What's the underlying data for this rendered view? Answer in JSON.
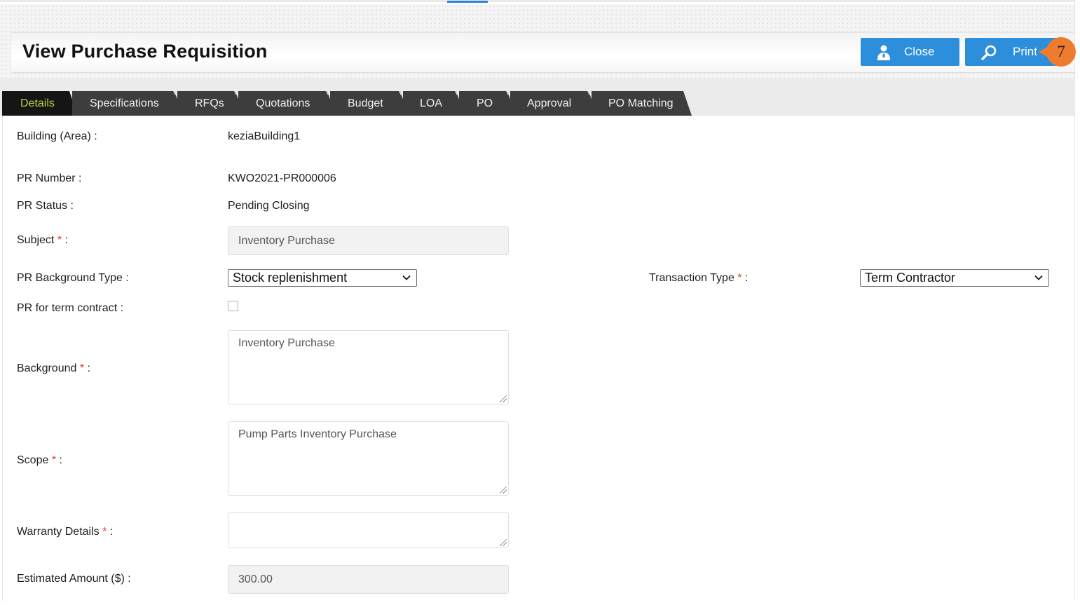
{
  "header": {
    "title": "View Purchase Requisition",
    "close_label": "Close",
    "print_label": "Print",
    "step_badge": "7",
    "accent_color": "#2d8fdb",
    "badge_color": "#ef7c2e"
  },
  "tabs": [
    {
      "label": "Details",
      "active": true
    },
    {
      "label": "Specifications"
    },
    {
      "label": "RFQs"
    },
    {
      "label": "Quotations"
    },
    {
      "label": "Budget"
    },
    {
      "label": "LOA"
    },
    {
      "label": "PO"
    },
    {
      "label": "Approval"
    },
    {
      "label": "PO Matching"
    }
  ],
  "form": {
    "building": {
      "label": "Building (Area) :",
      "value": "keziaBuilding1"
    },
    "pr_number": {
      "label": "PR Number :",
      "value": "KWO2021-PR000006"
    },
    "pr_status": {
      "label": "PR Status :",
      "value": "Pending Closing"
    },
    "subject": {
      "label": "Subject",
      "suffix": " :",
      "value": "Inventory Purchase"
    },
    "pr_background_type": {
      "label": "PR Background Type :",
      "value": "Stock replenishment"
    },
    "transaction_type": {
      "label": "Transaction Type",
      "suffix": " :",
      "value": "Term Contractor"
    },
    "pr_term_contract": {
      "label": "PR for term contract :",
      "checked": false
    },
    "background": {
      "label": "Background",
      "suffix": " :",
      "value": "Inventory Purchase"
    },
    "scope": {
      "label": "Scope",
      "suffix": " :",
      "value": "Pump Parts Inventory Purchase"
    },
    "warranty": {
      "label": "Warranty Details",
      "suffix": " :",
      "value": ""
    },
    "estimated_amount": {
      "label": "Estimated Amount ($) :",
      "value": "300.00"
    },
    "required_mark": "*"
  }
}
